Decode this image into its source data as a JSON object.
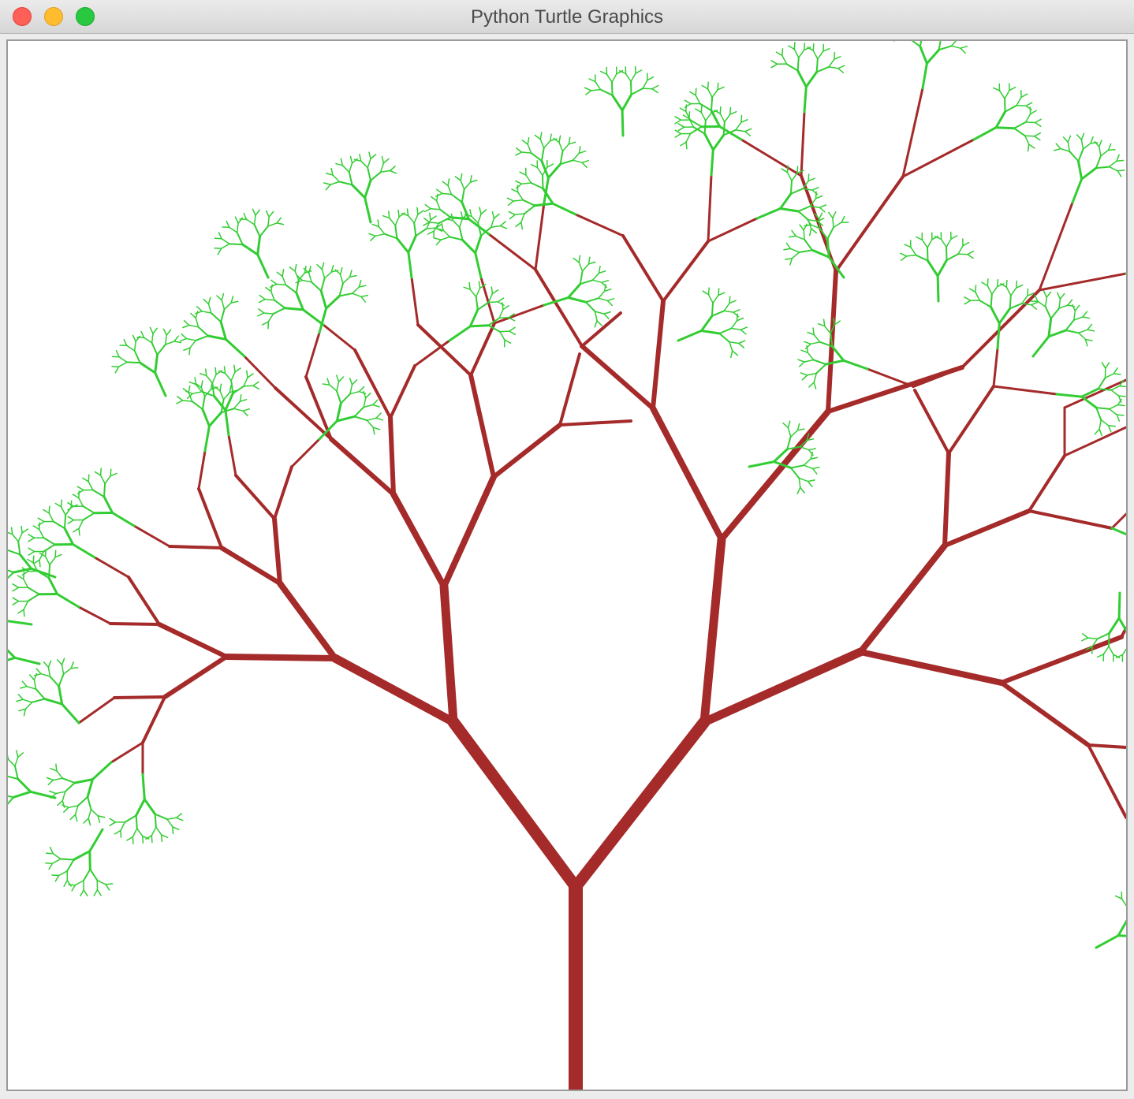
{
  "window": {
    "title": "Python Turtle Graphics"
  },
  "colors": {
    "trunk": "#a52a2a",
    "leaf": "#32cd32",
    "canvas": "#ffffff"
  },
  "icons": {
    "close": "close-icon",
    "minimize": "minimize-icon",
    "zoom": "zoom-icon"
  }
}
